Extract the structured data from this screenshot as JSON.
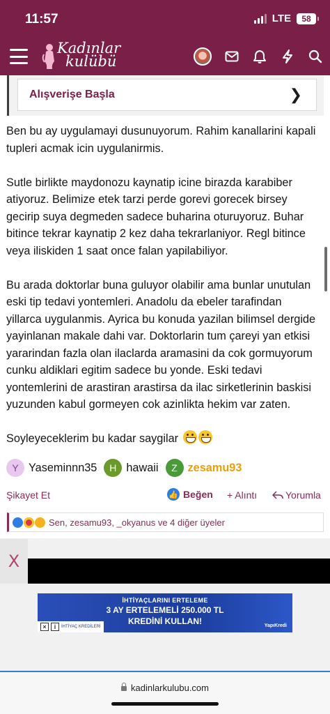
{
  "status_bar": {
    "time": "11:57",
    "network": "LTE",
    "battery": "58"
  },
  "app_bar": {
    "logo_line1": "Kadınlar",
    "logo_line2": "kulübü",
    "brand_color": "#7a2048"
  },
  "promo": {
    "label": "Alışverişe Başla",
    "chevron": "❯"
  },
  "post": {
    "paragraphs": [
      "Ben bu ay uygulamayi dusunuyorum. Rahim kanallarini kapali tupleri acmak icin uygulanirmis.",
      "Sutle birlikte maydonozu kaynatip icine birazda karabiber atiyoruz. Belimize etek tarzi perde gorevi gorecek birsey gecirip suya degmeden sadece buharina oturuyoruz. Buhar bitince tekrar kaynatip 2 kez daha tekrarlaniyor. Regl bitince veya iliskiden 1 saat once falan yapilabiliyor.",
      "Bu arada doktorlar buna guluyor olabilir ama bunlar unutulan eski tip tedavi yontemleri. Anadolu da ebeler tarafindan yillarca uygulanmis. Ayrica bu konuda yazilan bilimsel dergide yayinlanan makale dahi var. Doktorlarin tum çareyi yan etkisi yararindan fazla olan ilaclarda aramasini da cok gormuyorum cunku aldiklari egitim sadece bu yonde. Eski tedavi yontemlerini de arastiran arastirsa da ilac sirketlerinin baskisi yuzunden kabul gormeyen cok azinlikta hekim var zaten.",
      "Soyleyeceklerim bu kadar saygilar"
    ],
    "closing_emoji": [
      "grinning-sweat-emoji",
      "grinning-sweat-emoji"
    ]
  },
  "mentions": [
    {
      "initial": "Y",
      "name": "Yaseminnn35",
      "avatar_bg": "#e8c8ee",
      "avatar_fg": "#7a4a8a",
      "highlight": false
    },
    {
      "initial": "H",
      "name": "hawaii",
      "avatar_bg": "#6a9a2a",
      "avatar_fg": "#ffffff",
      "highlight": false
    },
    {
      "initial": "Z",
      "name": "zesamu93",
      "avatar_bg": "#4a9a3a",
      "avatar_fg": "#ffffff",
      "highlight": true
    }
  ],
  "actions": {
    "report": "Şikayet Et",
    "like": "Beğen",
    "quote": "+ Alıntı",
    "reply": "Yorumla"
  },
  "reactions": {
    "summary": "Sen, zesamu93, _okyanus ve 4 diğer üyeler",
    "icons": [
      "like-reaction-icon",
      "love-reaction-icon",
      "laugh-reaction-icon"
    ]
  },
  "ad": {
    "close": "X",
    "line1": "İHTİYAÇLARINI ERTELEME",
    "line2": "3 AY ERTELEMELİ 250.000 TL",
    "line3": "KREDİNİ KULLAN!",
    "brand": "YapıKredi",
    "tag": "İHTİYAÇ KREDİLERİ"
  },
  "browser": {
    "url": "kadinlarkulubu.com"
  }
}
